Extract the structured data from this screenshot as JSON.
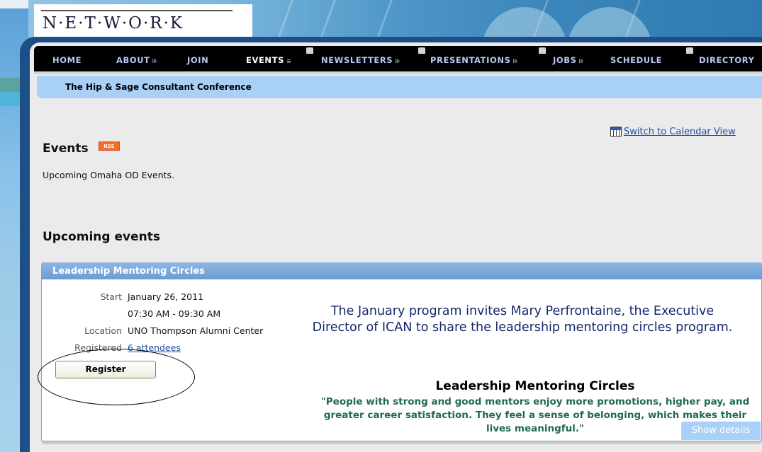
{
  "header": {
    "logo_text": "N·E·T·W·O·R·K"
  },
  "nav": {
    "items": [
      {
        "label": "HOME"
      },
      {
        "label": "ABOUT",
        "arrow": "⊪"
      },
      {
        "label": "JOIN"
      },
      {
        "label": "EVENTS",
        "arrow": "≡"
      },
      {
        "label": "NEWSLETTERS",
        "arrow": "⊪"
      },
      {
        "label": "PRESENTATIONS",
        "arrow": "⊪"
      },
      {
        "label": "JOBS",
        "arrow": "⊪"
      },
      {
        "label": "SCHEDULE"
      },
      {
        "label": "DIRECTORY"
      }
    ]
  },
  "subnav": {
    "label": "The Hip & Sage Consultant Conference"
  },
  "page": {
    "calendar_link": "Switch to Calendar View",
    "title": "Events",
    "rss_badge": "RSS",
    "description": "Upcoming Omaha OD Events.",
    "section_title": "Upcoming events"
  },
  "event": {
    "title": "Leadership Mentoring Circles",
    "start_label": "Start",
    "start_date": "January 26, 2011",
    "time": "07:30 AM - 09:30 AM",
    "location_label": "Location",
    "location": "UNO Thompson Alumni Center",
    "registered_label": "Registered",
    "attendees": "6 attendees",
    "register_button": "Register",
    "summary": "The January program invites Mary Perfrontaine, the Executive Director of ICAN to share the leadership mentoring circles program.",
    "heading": "Leadership Mentoring Circles",
    "quote": "\"People with strong and good mentors enjoy more promotions, higher pay, and greater career satisfaction.  They feel a sense of belonging, which makes their lives meaningful.\"",
    "show_details": "Show details"
  }
}
